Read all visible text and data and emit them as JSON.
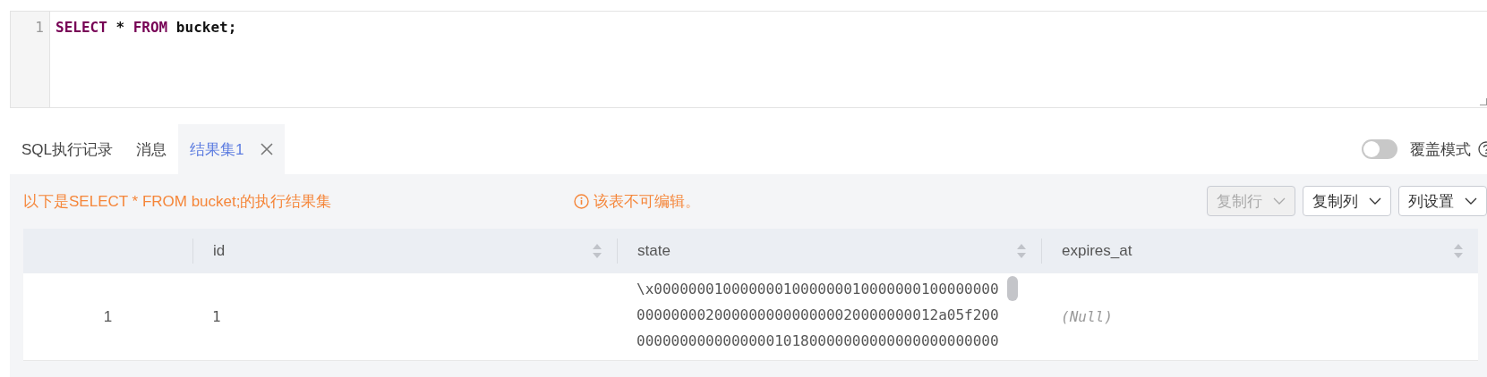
{
  "editor": {
    "lines": [
      {
        "number": "1",
        "tokens": [
          {
            "kind": "keyword",
            "text": "SELECT"
          },
          {
            "kind": "plain",
            "text": " * "
          },
          {
            "kind": "keyword",
            "text": "FROM"
          },
          {
            "kind": "plain",
            "text": " bucket;"
          }
        ]
      }
    ]
  },
  "tabs": [
    {
      "label": "SQL执行记录",
      "selected": false,
      "closable": false
    },
    {
      "label": "消息",
      "selected": false,
      "closable": false
    },
    {
      "label": "结果集1",
      "selected": true,
      "closable": true
    }
  ],
  "overlay_mode": {
    "label": "覆盖模式",
    "on": false
  },
  "result": {
    "summary": "以下是SELECT * FROM bucket;的执行结果集",
    "notice": "该表不可编辑。",
    "buttons": [
      {
        "label": "复制行",
        "disabled": true
      },
      {
        "label": "复制列",
        "disabled": false
      },
      {
        "label": "列设置",
        "disabled": false
      }
    ],
    "columns": [
      {
        "kind": "index"
      },
      {
        "kind": "data",
        "label": "id"
      },
      {
        "kind": "data",
        "label": "state"
      },
      {
        "kind": "data",
        "label": "expires_at"
      }
    ],
    "rows": [
      {
        "cells": [
          {
            "kind": "index",
            "lines": [
              "1"
            ]
          },
          {
            "kind": "value",
            "lines": [
              "1"
            ]
          },
          {
            "kind": "value",
            "lines": [
              "\\x0000000100000001000000010000000100000000",
              "00000000200000000000000020000000012a05f200",
              "000000000000000010180000000000000000000000"
            ]
          },
          {
            "kind": "null",
            "lines": [
              "(Null)"
            ]
          }
        ]
      }
    ]
  }
}
